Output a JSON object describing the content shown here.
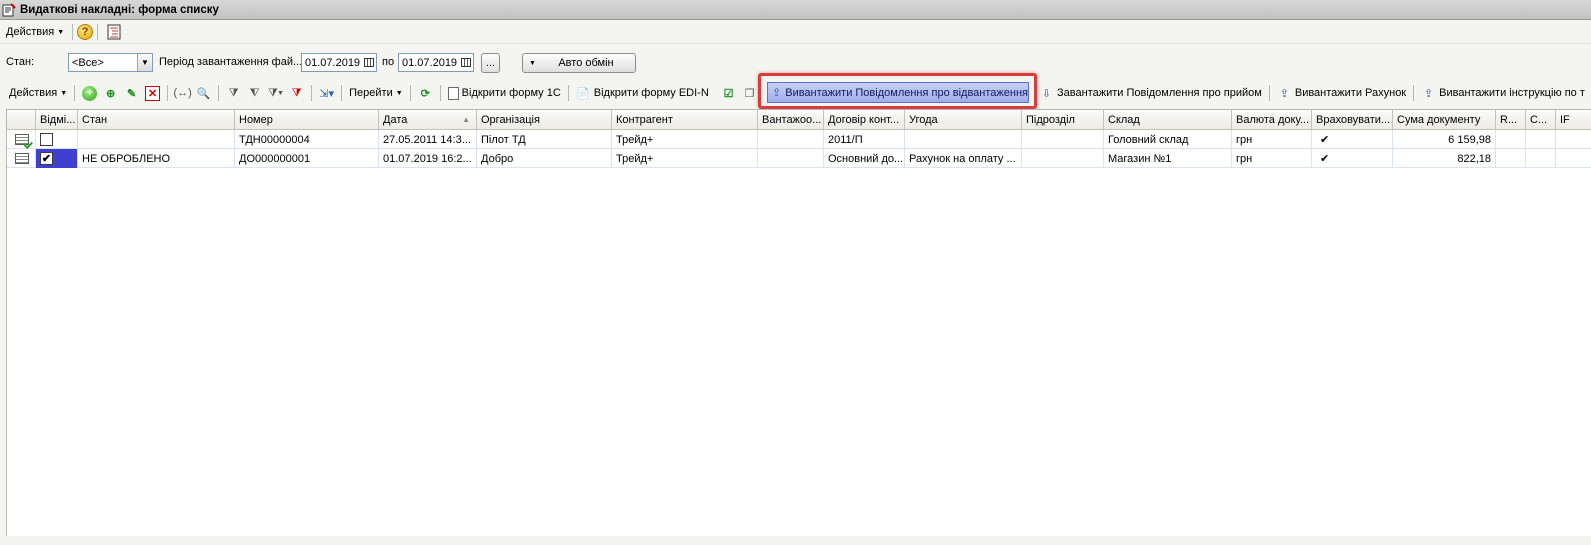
{
  "window": {
    "title": "Видаткові накладні: форма списку"
  },
  "menubar": {
    "actions_label": "Действия"
  },
  "filter": {
    "state_label": "Стан:",
    "state_value": "<Все>",
    "period_label": "Період завантаження фай...",
    "date_from": "01.07.2019",
    "to_label": "по",
    "date_to": "01.07.2019",
    "ellipsis_label": "...",
    "auto_exchange_label": "Авто обмін"
  },
  "toolbar": {
    "actions_label": "Действия",
    "goto_label": "Перейти",
    "open_1c_label": "Відкрити форму 1С",
    "open_edin_label": "Відкрити форму EDI-N",
    "export_shipment_label": "Вивантажити Повідомлення про відвантаження",
    "load_receipt_label": "Завантажити Повідомлення про прийом",
    "export_invoice_label": "Вивантажити Рахунок",
    "export_instruction_label": "Вивантажити інструкцію по т"
  },
  "grid": {
    "columns": [
      "Відмі...",
      "Стан",
      "Номер",
      "Дата",
      "Організація",
      "Контрагент",
      "Вантажоо...",
      "Договір конт...",
      "Угода",
      "Підрозділ",
      "Склад",
      "Валюта доку...",
      "Враховувати...",
      "Сума документу",
      "R...",
      "С...",
      "IF"
    ],
    "rows": [
      {
        "checked": "",
        "state": "",
        "number": "ТДН00000004",
        "date": "27.05.2011 14:3...",
        "org": "Пілот ТД",
        "contractor": "Трейд+",
        "consignee": "",
        "contract": "2011/П",
        "deal": "",
        "division": "",
        "warehouse": "Головний склад",
        "currency": "грн",
        "consider": "✔",
        "sum": "6 159,98"
      },
      {
        "checked": "✔",
        "state": "НЕ ОБРОБЛЕНО",
        "number": "ДО000000001",
        "date": "01.07.2019 16:2...",
        "org": "Добро",
        "contractor": "Трейд+",
        "consignee": "",
        "contract": "Основний до...",
        "deal": "Рахунок на оплату ...",
        "division": "",
        "warehouse": "Магазин №1",
        "currency": "грн",
        "consider": "✔",
        "sum": "822,18"
      }
    ]
  }
}
